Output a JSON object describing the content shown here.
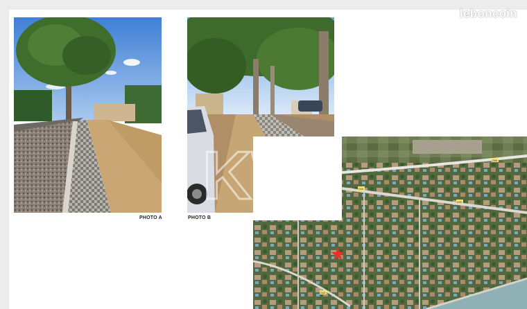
{
  "watermark": "leboncoin",
  "photo_a": {
    "caption": "PHOTO A"
  },
  "photo_b": {
    "caption": "PHOTO B",
    "overlay": "KW"
  },
  "map": {
    "road_labels": [
      "D66",
      "D20",
      "D20",
      "D20"
    ],
    "marker_icon": "red-star-marker"
  }
}
